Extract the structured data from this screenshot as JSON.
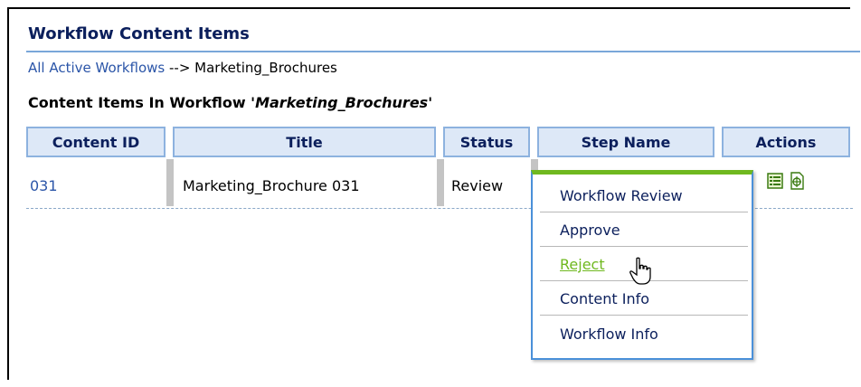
{
  "page": {
    "title": "Workflow Content Items",
    "breadcrumb_link": "All Active Workflows",
    "breadcrumb_sep": " --> ",
    "breadcrumb_current": "Marketing_Brochures",
    "section_prefix": "Content Items In Workflow ",
    "section_name": "'Marketing_Brochures'"
  },
  "table": {
    "headers": [
      "Content ID",
      "Title",
      "Status",
      "Step Name",
      "Actions"
    ],
    "rows": [
      {
        "content_id": "031",
        "title": "Marketing_Brochure 031",
        "status": "Review"
      }
    ]
  },
  "context_menu": {
    "items": [
      "Workflow Review",
      "Approve",
      "Reject",
      "Content Info",
      "Workflow Info"
    ],
    "hover_item": "Reject"
  },
  "colors": {
    "header_fill": "#dde8f7",
    "header_border": "#8db2df",
    "menu_border": "#4a90d9",
    "menu_top": "#6fb81f",
    "link": "#2b55a8"
  },
  "icons": [
    "list-icon",
    "info-page-icon",
    "hand-cursor-icon"
  ]
}
